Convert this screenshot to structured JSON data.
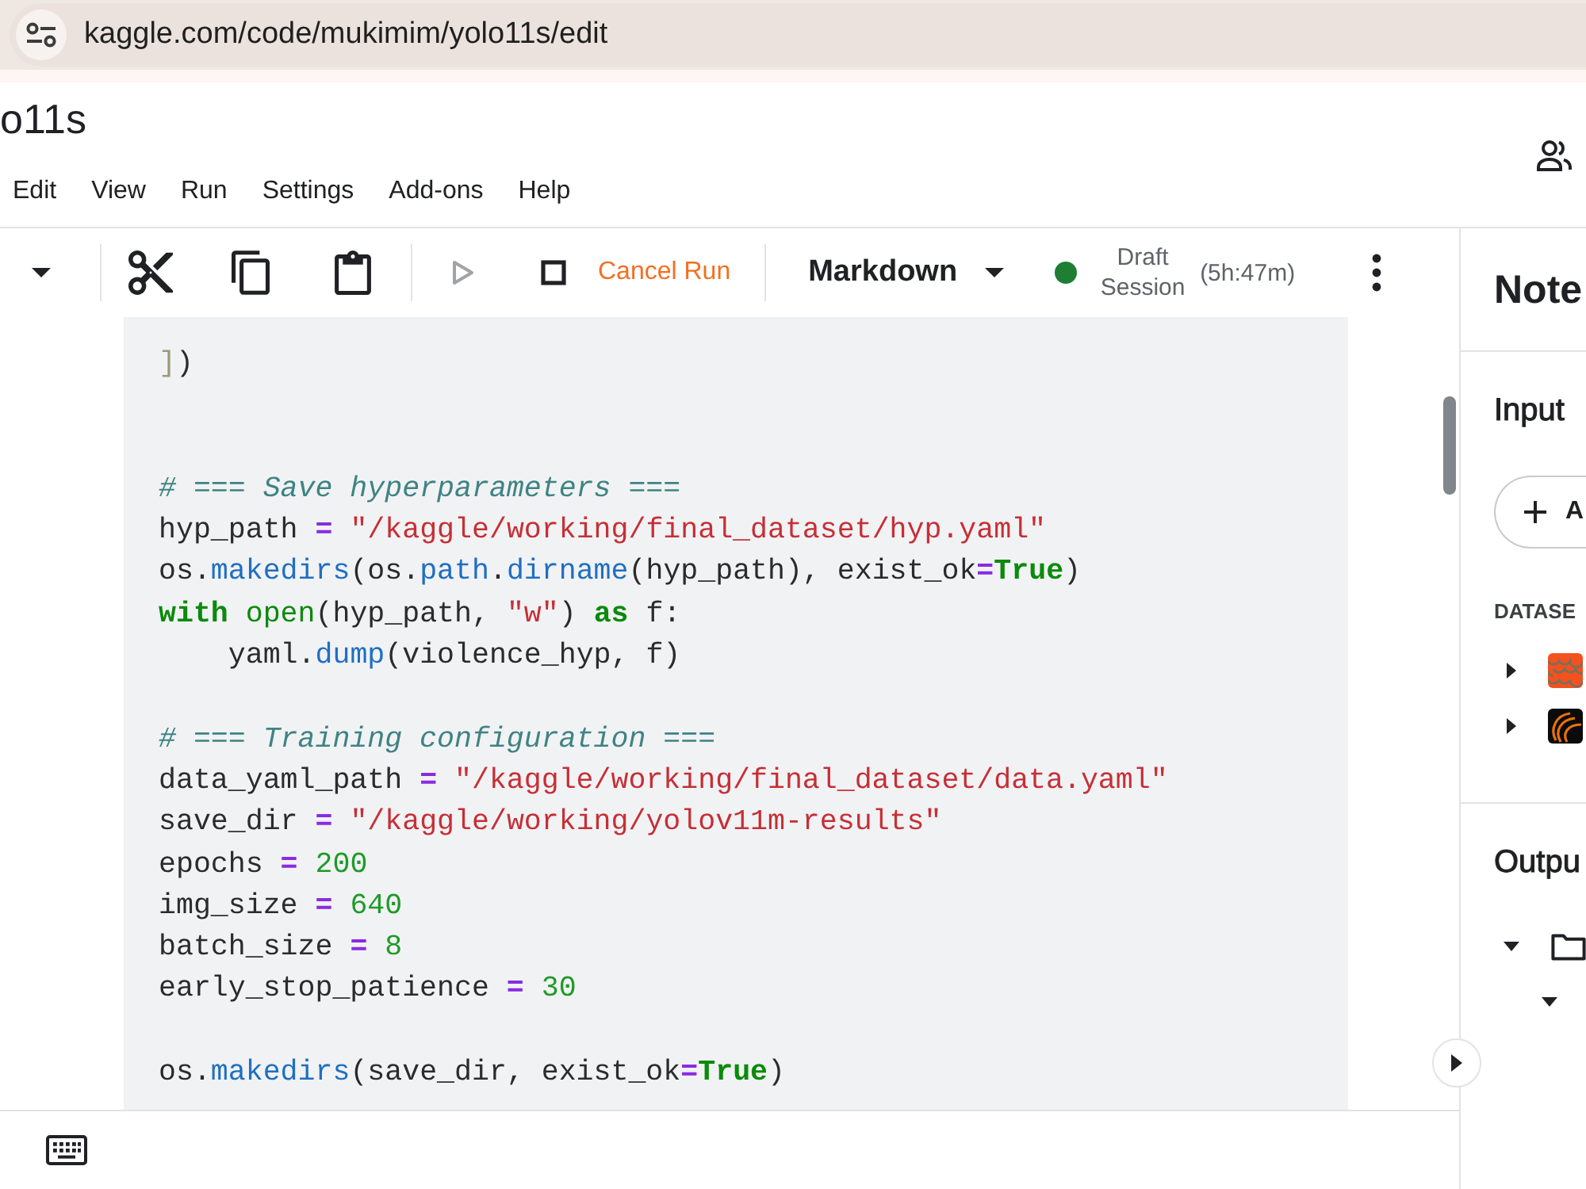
{
  "browser": {
    "url": "kaggle.com/code/mukimim/yolo11s/edit"
  },
  "notebook": {
    "title": "o11s"
  },
  "menu": [
    "Edit",
    "View",
    "Run",
    "Settings",
    "Add-ons",
    "Help"
  ],
  "toolbar": {
    "groups": [
      [
        {
          "kind": "dropdown",
          "disabled": false
        }
      ],
      [
        {
          "kind": "cut",
          "disabled": false
        },
        {
          "kind": "copy",
          "disabled": false
        },
        {
          "kind": "paste",
          "disabled": false
        }
      ],
      [
        {
          "kind": "run",
          "disabled": true
        },
        {
          "kind": "stop",
          "disabled": false
        },
        {
          "kind": "cancel",
          "label": "Cancel Run",
          "disabled": false
        }
      ]
    ],
    "cell_type": "Markdown",
    "session": {
      "running": true,
      "label": "Draft Session",
      "time": "(5h:47m)"
    }
  },
  "code": [
    {
      "kind": "code",
      "tokens": [
        {
          "kind": "dim",
          "text": "]"
        },
        {
          "kind": "plain",
          "text": ")"
        }
      ]
    },
    {
      "kind": "blank"
    },
    {
      "kind": "blank"
    },
    {
      "kind": "code",
      "tokens": [
        {
          "kind": "comment",
          "text": "# === Save hyperparameters ==="
        }
      ]
    },
    {
      "kind": "code",
      "tokens": [
        {
          "kind": "plain",
          "text": "hyp_path "
        },
        {
          "kind": "op",
          "text": "= "
        },
        {
          "kind": "string",
          "text": "\"/kaggle/working/final_dataset/hyp.yaml\""
        }
      ]
    },
    {
      "kind": "code",
      "tokens": [
        {
          "kind": "plain",
          "text": "os."
        },
        {
          "kind": "func",
          "text": "makedirs"
        },
        {
          "kind": "plain",
          "text": "(os."
        },
        {
          "kind": "func",
          "text": "path"
        },
        {
          "kind": "plain",
          "text": "."
        },
        {
          "kind": "func",
          "text": "dirname"
        },
        {
          "kind": "plain",
          "text": "(hyp_path), exist_ok"
        },
        {
          "kind": "op",
          "text": "="
        },
        {
          "kind": "keyword",
          "text": "True"
        },
        {
          "kind": "plain",
          "text": ")"
        }
      ]
    },
    {
      "kind": "code",
      "tokens": [
        {
          "kind": "keyword",
          "text": "with "
        },
        {
          "kind": "builtin",
          "text": "open"
        },
        {
          "kind": "plain",
          "text": "(hyp_path, "
        },
        {
          "kind": "string",
          "text": "\"w\""
        },
        {
          "kind": "plain",
          "text": ") "
        },
        {
          "kind": "keyword",
          "text": "as"
        },
        {
          "kind": "plain",
          "text": " f:"
        }
      ]
    },
    {
      "kind": "code",
      "tokens": [
        {
          "kind": "plain",
          "text": "    yaml."
        },
        {
          "kind": "func",
          "text": "dump"
        },
        {
          "kind": "plain",
          "text": "(violence_hyp, f)"
        }
      ]
    },
    {
      "kind": "blank"
    },
    {
      "kind": "code",
      "tokens": [
        {
          "kind": "comment",
          "text": "# === Training configuration ==="
        }
      ]
    },
    {
      "kind": "code",
      "tokens": [
        {
          "kind": "plain",
          "text": "data_yaml_path "
        },
        {
          "kind": "op",
          "text": "= "
        },
        {
          "kind": "string",
          "text": "\"/kaggle/working/final_dataset/data.yaml\""
        }
      ]
    },
    {
      "kind": "code",
      "tokens": [
        {
          "kind": "plain",
          "text": "save_dir "
        },
        {
          "kind": "op",
          "text": "= "
        },
        {
          "kind": "string",
          "text": "\"/kaggle/working/yolov11m-results\""
        }
      ]
    },
    {
      "kind": "code",
      "tokens": [
        {
          "kind": "plain",
          "text": "epochs "
        },
        {
          "kind": "op",
          "text": "= "
        },
        {
          "kind": "number",
          "text": "200"
        }
      ]
    },
    {
      "kind": "code",
      "tokens": [
        {
          "kind": "plain",
          "text": "img_size "
        },
        {
          "kind": "op",
          "text": "= "
        },
        {
          "kind": "number",
          "text": "640"
        }
      ]
    },
    {
      "kind": "code",
      "tokens": [
        {
          "kind": "plain",
          "text": "batch_size "
        },
        {
          "kind": "op",
          "text": "= "
        },
        {
          "kind": "number",
          "text": "8"
        }
      ]
    },
    {
      "kind": "code",
      "tokens": [
        {
          "kind": "plain",
          "text": "early_stop_patience "
        },
        {
          "kind": "op",
          "text": "= "
        },
        {
          "kind": "number",
          "text": "30"
        }
      ]
    },
    {
      "kind": "blank"
    },
    {
      "kind": "code",
      "tokens": [
        {
          "kind": "plain",
          "text": "os."
        },
        {
          "kind": "func",
          "text": "makedirs"
        },
        {
          "kind": "plain",
          "text": "(save_dir, exist_ok"
        },
        {
          "kind": "op",
          "text": "="
        },
        {
          "kind": "keyword",
          "text": "True"
        },
        {
          "kind": "plain",
          "text": ")"
        }
      ]
    }
  ],
  "sidebar": {
    "title": "Note",
    "input": {
      "heading": "Input",
      "add_label": "A",
      "datasets_heading": "DATASE",
      "datasets": [
        {
          "kind": "pattern",
          "expanded": false
        },
        {
          "kind": "swirl",
          "expanded": false
        }
      ]
    },
    "output": {
      "heading": "Outpu",
      "tree": [
        {
          "kind": "folder",
          "expanded": true,
          "children": [
            {
              "expanded": true
            }
          ]
        }
      ]
    }
  }
}
